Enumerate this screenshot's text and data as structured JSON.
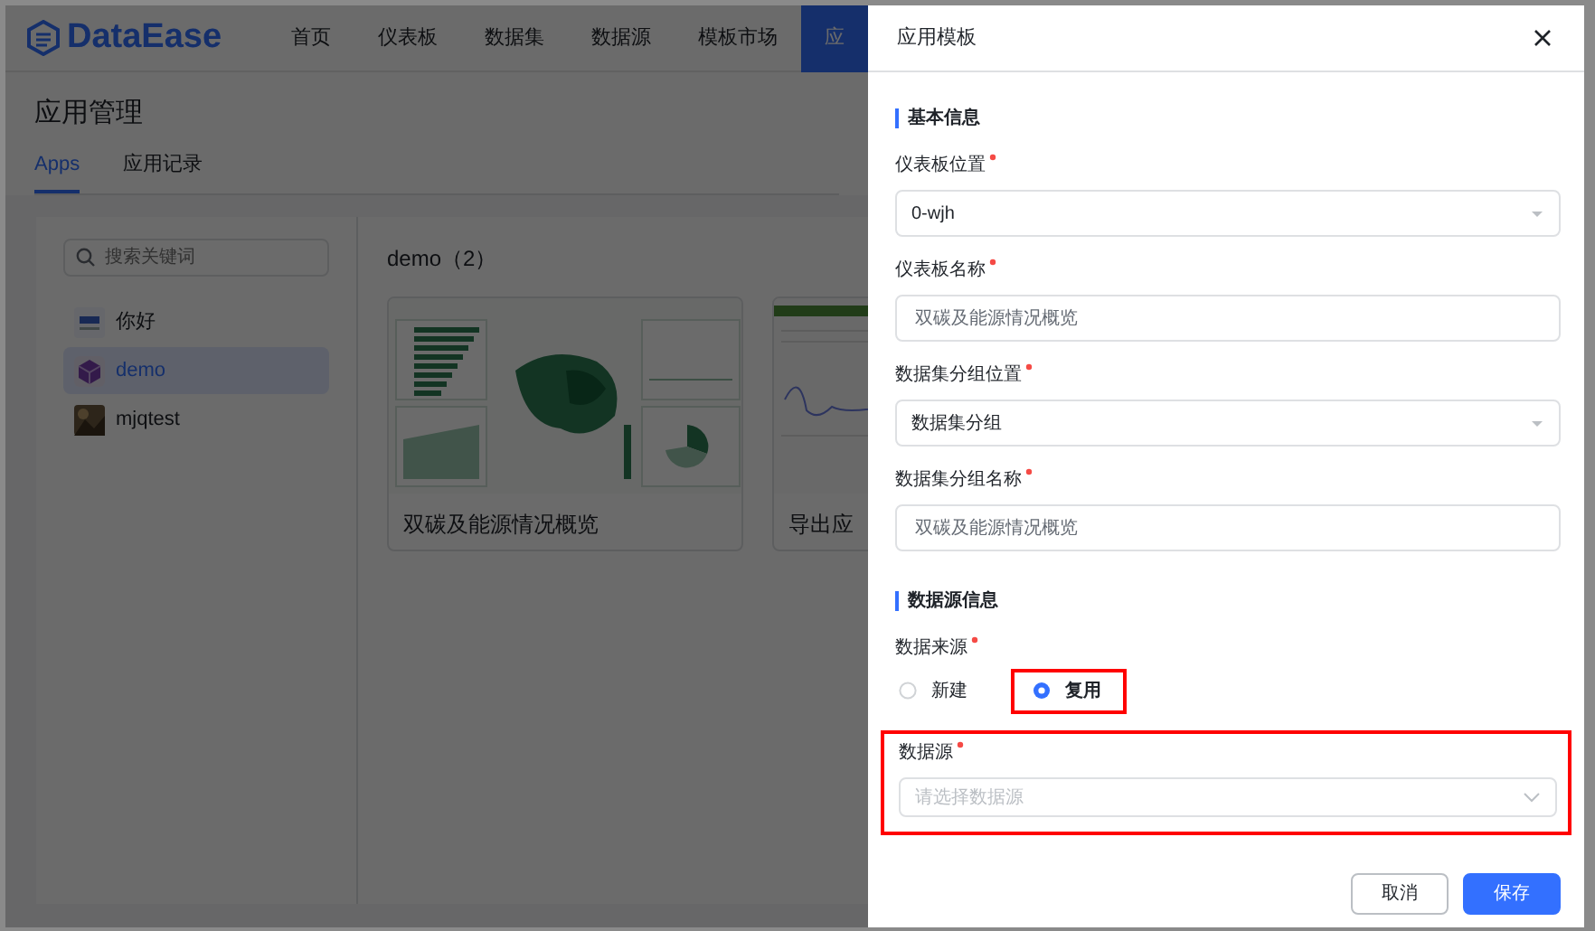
{
  "header": {
    "logo": "DataEase",
    "nav": [
      {
        "label": "首页",
        "selected": false
      },
      {
        "label": "仪表板",
        "selected": false
      },
      {
        "label": "数据集",
        "selected": false
      },
      {
        "label": "数据源",
        "selected": false
      },
      {
        "label": "模板市场",
        "selected": false
      },
      {
        "label": "应",
        "selected": true
      }
    ]
  },
  "page": {
    "title": "应用管理",
    "tabs": [
      {
        "label": "Apps",
        "selected": true
      },
      {
        "label": "应用记录",
        "selected": false
      }
    ]
  },
  "sidebar": {
    "search": {
      "placeholder": "搜索关键词"
    },
    "items": [
      {
        "label": "你好",
        "kind": "logo",
        "selected": false
      },
      {
        "label": "demo",
        "kind": "cube",
        "selected": true
      },
      {
        "label": "mjqtest",
        "selected": false
      }
    ]
  },
  "group": {
    "title": "demo（2）",
    "cards": [
      {
        "title": "双碳及能源情况概览",
        "kind": "map"
      },
      {
        "title": "导出应",
        "kind": "line"
      }
    ]
  },
  "drawer": {
    "title": "应用模板",
    "sections": [
      {
        "title": "基本信息",
        "fields": [
          {
            "label": "仪表板位置",
            "required": true,
            "kind": "select",
            "value": "0-wjh"
          },
          {
            "label": "仪表板名称",
            "required": true,
            "kind": "input",
            "value": "双碳及能源情况概览"
          },
          {
            "label": "数据集分组位置",
            "required": true,
            "kind": "select",
            "value": "数据集分组"
          },
          {
            "label": "数据集分组名称",
            "required": true,
            "kind": "input",
            "value": "双碳及能源情况概览"
          }
        ]
      },
      {
        "title": "数据源信息",
        "fields": [
          {
            "label": "数据来源",
            "required": true,
            "kind": "radio",
            "options": [
              {
                "label": "新建",
                "selected": false,
                "highlighted": false
              },
              {
                "label": "复用",
                "selected": true,
                "highlighted": true
              }
            ]
          },
          {
            "label": "数据源",
            "required": true,
            "kind": "dropdown",
            "placeholder": "请选择数据源",
            "highlighted": true
          }
        ]
      }
    ],
    "buttons": [
      {
        "label": "取消",
        "kind": "secondary"
      },
      {
        "label": "保存",
        "kind": "primary"
      }
    ]
  }
}
